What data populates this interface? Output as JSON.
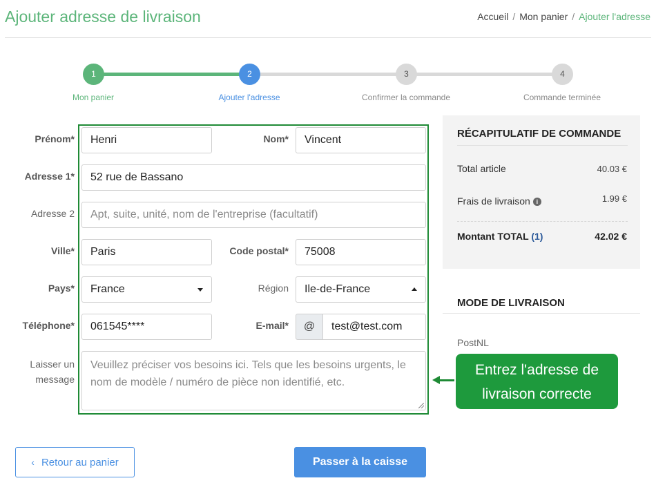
{
  "header": {
    "title": "Ajouter adresse de livraison",
    "breadcrumb": {
      "home": "Accueil",
      "cart": "Mon panier",
      "current": "Ajouter l'adresse",
      "separator": "/"
    }
  },
  "steps": [
    {
      "num": "1",
      "label": "Mon panier",
      "state": "done"
    },
    {
      "num": "2",
      "label": "Ajouter l'adresse",
      "state": "active"
    },
    {
      "num": "3",
      "label": "Confirmer la commande",
      "state": "todo"
    },
    {
      "num": "4",
      "label": "Commande terminée",
      "state": "todo"
    }
  ],
  "colors": {
    "brand_green": "#5cb57a",
    "active_blue": "#4a90e2",
    "inactive_gray": "#d9d9d9",
    "callout_green": "#1e9a3d"
  },
  "form": {
    "prenom": {
      "label": "Prénom*",
      "value": "Henri"
    },
    "nom": {
      "label": "Nom*",
      "value": "Vincent"
    },
    "adresse1": {
      "label": "Adresse 1*",
      "value": "52 rue de Bassano"
    },
    "adresse2": {
      "label": "Adresse 2",
      "placeholder": "Apt, suite, unité, nom de l'entreprise (facultatif)"
    },
    "ville": {
      "label": "Ville*",
      "value": "Paris"
    },
    "code_postal": {
      "label": "Code postal*",
      "value": "75008"
    },
    "pays": {
      "label": "Pays*",
      "value": "France"
    },
    "region": {
      "label": "Région",
      "value": "Ile-de-France"
    },
    "telephone": {
      "label": "Téléphone*",
      "value": "061545****"
    },
    "email": {
      "label": "E-mail*",
      "addon": "@",
      "value": "test@test.com"
    },
    "message": {
      "label_line1": "Laisser un",
      "label_line2": "message",
      "placeholder": "Veuillez préciser vos besoins ici. Tels que les besoins urgents, le nom de modèle / numéro de pièce non identifié, etc."
    }
  },
  "summary": {
    "title": "RÉCAPITULATIF DE COMMANDE",
    "total_article_label": "Total article",
    "total_article_value": "40.03 €",
    "shipping_label": "Frais de livraison",
    "shipping_info_icon": "info-icon",
    "shipping_value": "1.99 €",
    "total_label": "Montant TOTAL",
    "total_count": "(1)",
    "total_value": "42.02 €"
  },
  "shipping": {
    "title": "MODE DE LIVRAISON",
    "option": "PostNL"
  },
  "callout": {
    "line1": "Entrez l'adresse de",
    "line2": "livraison correcte"
  },
  "buttons": {
    "back_icon": "chevron-left-icon",
    "back_label": "Retour au panier",
    "checkout_label": "Passer à la caisse"
  }
}
